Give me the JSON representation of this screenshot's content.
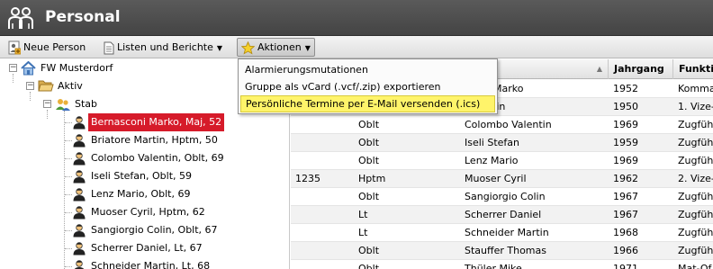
{
  "app": {
    "title": "Personal",
    "icon": "people-icon"
  },
  "toolbar": {
    "new_person": "Neue Person",
    "lists_reports": "Listen und Berichte",
    "actions": "Aktionen"
  },
  "menu": {
    "items": [
      "Alarmierungsmutationen",
      "Gruppe als vCard (.vcf/.zip) exportieren",
      "Persönliche Termine per E-Mail versenden (.ics)"
    ],
    "highlighted_index": 2
  },
  "tree": {
    "root": "FW Musterdorf",
    "group": "Aktiv",
    "subgroup": "Stab",
    "people": [
      "Bernasconi Marko, Maj, 52",
      "Briatore Martin, Hptm, 50",
      "Colombo Valentin, Oblt, 69",
      "Iseli Stefan, Oblt, 59",
      "Lenz Mario, Oblt, 69",
      "Muoser Cyril, Hptm, 62",
      "Sangiorgio Colin, Oblt, 67",
      "Scherrer Daniel, Lt, 67",
      "Schneider Martin, Lt, 68"
    ],
    "selected_index": 0,
    "colors": {
      "selected_bg": "#d61b2a",
      "selected_fg": "#ffffff"
    }
  },
  "grid": {
    "columns": [
      "",
      "",
      "",
      "Jahrgang",
      "Funkti"
    ],
    "rows": [
      [
        "",
        "",
        "sconi Marko",
        "1952",
        "Komma"
      ],
      [
        "",
        "",
        "e Martin",
        "1950",
        "1. Vize-"
      ],
      [
        "",
        "Oblt",
        "Colombo Valentin",
        "1969",
        "Zugfüh"
      ],
      [
        "",
        "Oblt",
        "Iseli Stefan",
        "1959",
        "Zugfüh"
      ],
      [
        "",
        "Oblt",
        "Lenz Mario",
        "1969",
        "Zugfüh"
      ],
      [
        "1235",
        "Hptm",
        "Muoser Cyril",
        "1962",
        "2. Vize-"
      ],
      [
        "",
        "Oblt",
        "Sangiorgio Colin",
        "1967",
        "Zugfüh"
      ],
      [
        "",
        "Lt",
        "Scherrer Daniel",
        "1967",
        "Zugfüh"
      ],
      [
        "",
        "Lt",
        "Schneider Martin",
        "1968",
        "Zugfüh"
      ],
      [
        "",
        "Oblt",
        "Stauffer Thomas",
        "1966",
        "Zugfüh"
      ],
      [
        "",
        "Oblt",
        "Thüler Mike",
        "1971",
        "Mat-Of"
      ]
    ]
  }
}
